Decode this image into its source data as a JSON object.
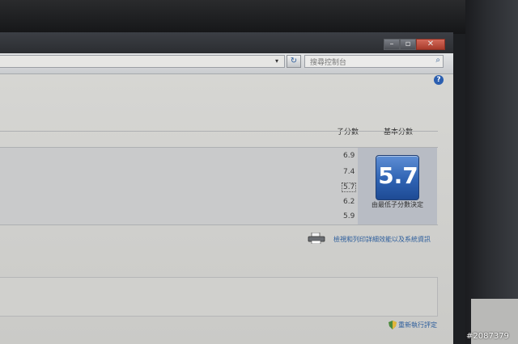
{
  "window": {
    "minimize_glyph": "–",
    "maximize_glyph": "▫",
    "close_glyph": "✕"
  },
  "addressbar": {
    "dropdown_glyph": "▾",
    "refresh_glyph": "↻",
    "search_placeholder": "搜尋控制台",
    "search_icon": "⌕"
  },
  "help": {
    "glyph": "?"
  },
  "table": {
    "header_subscore": "子分數",
    "header_basescore": "基本分數",
    "subscores": [
      "6.9",
      "7.4",
      "5.7",
      "6.2",
      "5.9"
    ],
    "selected_index": 2
  },
  "base": {
    "value": "5.7",
    "caption": "由最低子分數決定"
  },
  "links": {
    "print": "檢視和列印詳細效能以及系統資訊",
    "rescore": "重新執行評定"
  },
  "watermark": "#2087379",
  "colors": {
    "badge_top": "#5e8ed4",
    "badge_bottom": "#1e4b94",
    "link": "#2c5d9c"
  }
}
